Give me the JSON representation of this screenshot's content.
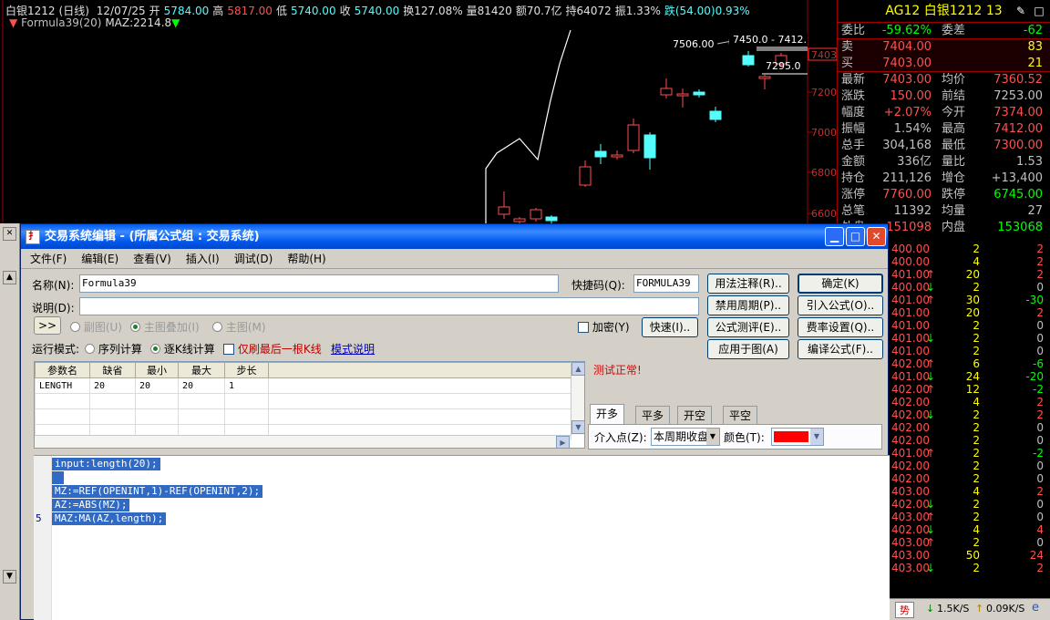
{
  "chart": {
    "symbol": "白银1212",
    "period": "(日线)",
    "date": "12/07/25",
    "open_label": "开",
    "open": "5784.00",
    "high_label": "高",
    "high": "5817.00",
    "low_label": "低",
    "low": "5740.00",
    "close_label": "收",
    "close": "5740.00",
    "turnover": "换127.08%",
    "volume": "量81420",
    "amount": "额70.7亿",
    "open_interest": "持64072",
    "amplitude": "振1.33%",
    "change": "跌(54.00)0.93%",
    "formula_name": "Formula39(20)",
    "formula_value": "MAZ:2214.8",
    "annotations": {
      "peak": "7506.00",
      "range": "7450.0 - 7412.",
      "mid": "7295.0",
      "marker": "7403"
    },
    "axis_ticks": [
      "7200",
      "7000",
      "6800",
      "6600"
    ]
  },
  "quote": {
    "title": "AG12 白银1212 13",
    "rows": [
      {
        "k1": "委比",
        "v1": "-59.62%",
        "c1": "#00ff00",
        "k2": "委差",
        "v2": "-62",
        "c2": "#00ff00"
      },
      {
        "k1": "卖",
        "v1": "7404.00",
        "c1": "#ff5050",
        "k2": "",
        "v2": "83",
        "c2": "#ffff00",
        "ob": true
      },
      {
        "k1": "买",
        "v1": "7403.00",
        "c1": "#ff5050",
        "k2": "",
        "v2": "21",
        "c2": "#ffff00",
        "ob": true
      },
      {
        "k1": "最新",
        "v1": "7403.00",
        "c1": "#ff5050",
        "k2": "均价",
        "v2": "7360.52",
        "c2": "#ff5050"
      },
      {
        "k1": "涨跌",
        "v1": "150.00",
        "c1": "#ff5050",
        "k2": "前结",
        "v2": "7253.00",
        "c2": "#c0c0c0"
      },
      {
        "k1": "幅度",
        "v1": "+2.07%",
        "c1": "#ff5050",
        "k2": "今开",
        "v2": "7374.00",
        "c2": "#ff5050"
      },
      {
        "k1": "振幅",
        "v1": "1.54%",
        "c1": "#c0c0c0",
        "k2": "最高",
        "v2": "7412.00",
        "c2": "#ff5050"
      },
      {
        "k1": "总手",
        "v1": "304,168",
        "c1": "#c0c0c0",
        "k2": "最低",
        "v2": "7300.00",
        "c2": "#ff5050"
      },
      {
        "k1": "金额",
        "v1": "336亿",
        "c1": "#c0c0c0",
        "k2": "量比",
        "v2": "1.53",
        "c2": "#c0c0c0"
      },
      {
        "k1": "持仓",
        "v1": "211,126",
        "c1": "#c0c0c0",
        "k2": "增仓",
        "v2": "+13,400",
        "c2": "#c0c0c0"
      },
      {
        "k1": "涨停",
        "v1": "7760.00",
        "c1": "#ff5050",
        "k2": "跌停",
        "v2": "6745.00",
        "c2": "#00ff00"
      },
      {
        "k1": "总笔",
        "v1": "11392",
        "c1": "#c0c0c0",
        "k2": "均量",
        "v2": "27",
        "c2": "#c0c0c0"
      },
      {
        "k1": "外盘",
        "v1": "151098",
        "c1": "#ff5050",
        "k2": "内盘",
        "v2": "153068",
        "c2": "#00ff00"
      }
    ],
    "ticks": [
      {
        "p": "400.00",
        "a": "",
        "v": "2",
        "c": "2",
        "cc": "#ff5050"
      },
      {
        "p": "400.00",
        "a": "",
        "v": "4",
        "c": "2",
        "cc": "#ff5050"
      },
      {
        "p": "401.00",
        "a": "↑",
        "v": "20",
        "c": "2",
        "cc": "#ff5050"
      },
      {
        "p": "400.00",
        "a": "↓",
        "v": "2",
        "c": "0",
        "cc": "#c0c0c0"
      },
      {
        "p": "401.00",
        "a": "↑",
        "v": "30",
        "c": "-30",
        "cc": "#00ff00"
      },
      {
        "p": "401.00",
        "a": "",
        "v": "20",
        "c": "2",
        "cc": "#ff5050"
      },
      {
        "p": "401.00",
        "a": "",
        "v": "2",
        "c": "0",
        "cc": "#c0c0c0"
      },
      {
        "p": "401.00",
        "a": "↓",
        "v": "2",
        "c": "0",
        "cc": "#c0c0c0"
      },
      {
        "p": "401.00",
        "a": "",
        "v": "2",
        "c": "0",
        "cc": "#c0c0c0"
      },
      {
        "p": "402.00",
        "a": "↑",
        "v": "6",
        "c": "-6",
        "cc": "#00ff00"
      },
      {
        "p": "401.00",
        "a": "↓",
        "v": "24",
        "c": "-20",
        "cc": "#00ff00"
      },
      {
        "p": "402.00",
        "a": "↑",
        "v": "12",
        "c": "-2",
        "cc": "#00ff00"
      },
      {
        "p": "402.00",
        "a": "",
        "v": "4",
        "c": "2",
        "cc": "#ff5050"
      },
      {
        "p": "402.00",
        "a": "↓",
        "v": "2",
        "c": "2",
        "cc": "#ff5050"
      },
      {
        "p": "402.00",
        "a": "",
        "v": "2",
        "c": "0",
        "cc": "#c0c0c0"
      },
      {
        "p": "402.00",
        "a": "",
        "v": "2",
        "c": "0",
        "cc": "#c0c0c0"
      },
      {
        "p": "401.00",
        "a": "↑",
        "v": "2",
        "c": "-2",
        "cc": "#00ff00"
      },
      {
        "p": "402.00",
        "a": "",
        "v": "2",
        "c": "0",
        "cc": "#c0c0c0"
      },
      {
        "p": "402.00",
        "a": "",
        "v": "2",
        "c": "0",
        "cc": "#c0c0c0"
      },
      {
        "p": "403.00",
        "a": "",
        "v": "4",
        "c": "2",
        "cc": "#ff5050"
      },
      {
        "p": "402.00",
        "a": "↓",
        "v": "2",
        "c": "0",
        "cc": "#c0c0c0"
      },
      {
        "p": "403.00",
        "a": "↑",
        "v": "2",
        "c": "0",
        "cc": "#c0c0c0"
      },
      {
        "p": "402.00",
        "a": "↓",
        "v": "4",
        "c": "4",
        "cc": "#ff5050"
      },
      {
        "p": "403.00",
        "a": "↑",
        "v": "2",
        "c": "0",
        "cc": "#c0c0c0"
      },
      {
        "p": "403.00",
        "a": "",
        "v": "50",
        "c": "24",
        "cc": "#ff5050"
      },
      {
        "p": "403.00",
        "a": "↓",
        "v": "2",
        "c": "2",
        "cc": "#ff5050"
      }
    ],
    "status": {
      "tab": "势",
      "down": "1.5K/S",
      "up": "0.09K/S"
    }
  },
  "dialog": {
    "title": "交易系统编辑 - (所属公式组 : 交易系统)",
    "menu": [
      "文件(F)",
      "编辑(E)",
      "查看(V)",
      "插入(I)",
      "调试(D)",
      "帮助(H)"
    ],
    "name_label": "名称(N):",
    "name_value": "Formula39",
    "shortcut_label": "快捷码(Q):",
    "shortcut_value": "FORMULA39",
    "desc_label": "说明(D):",
    "expand_label": ">>",
    "sub_chart": "副图(U)",
    "main_overlay": "主图叠加(I)",
    "main_chart": "主图(M)",
    "encrypt": "加密(Y)",
    "quick": "快速(I)..",
    "run_mode_label": "运行模式:",
    "seq_calc": "序列计算",
    "kline_calc": "逐K线计算",
    "refresh_last": "仅刷最后一根K线",
    "mode_help": "模式说明",
    "test_status": "测试正常!",
    "buttons": {
      "usage": "用法注释(R)..",
      "ok": "确定(K)",
      "disable_period": "禁用周期(P)..",
      "import": "引入公式(O)..",
      "evaluate": "公式测评(E)..",
      "fee": "费率设置(Q)..",
      "apply": "应用于图(A)",
      "compile": "编译公式(F).."
    },
    "param_headers": [
      "参数名",
      "缺省",
      "最小",
      "最大",
      "步长"
    ],
    "param_rows": [
      [
        "LENGTH",
        "20",
        "20",
        "20",
        "1"
      ]
    ],
    "tabs": [
      "开多",
      "平多",
      "开空",
      "平空"
    ],
    "entry_label": "介入点(Z):",
    "entry_value": "本周期收盘",
    "color_label": "颜色(T):",
    "color_value": "#ff0000",
    "code": [
      "input:length(20);",
      " ",
      "MZ:=REF(OPENINT,1)-REF(OPENINT,2);",
      "AZ:=ABS(MZ);",
      "MAZ:MA(AZ,length);"
    ],
    "line_number": "5"
  }
}
